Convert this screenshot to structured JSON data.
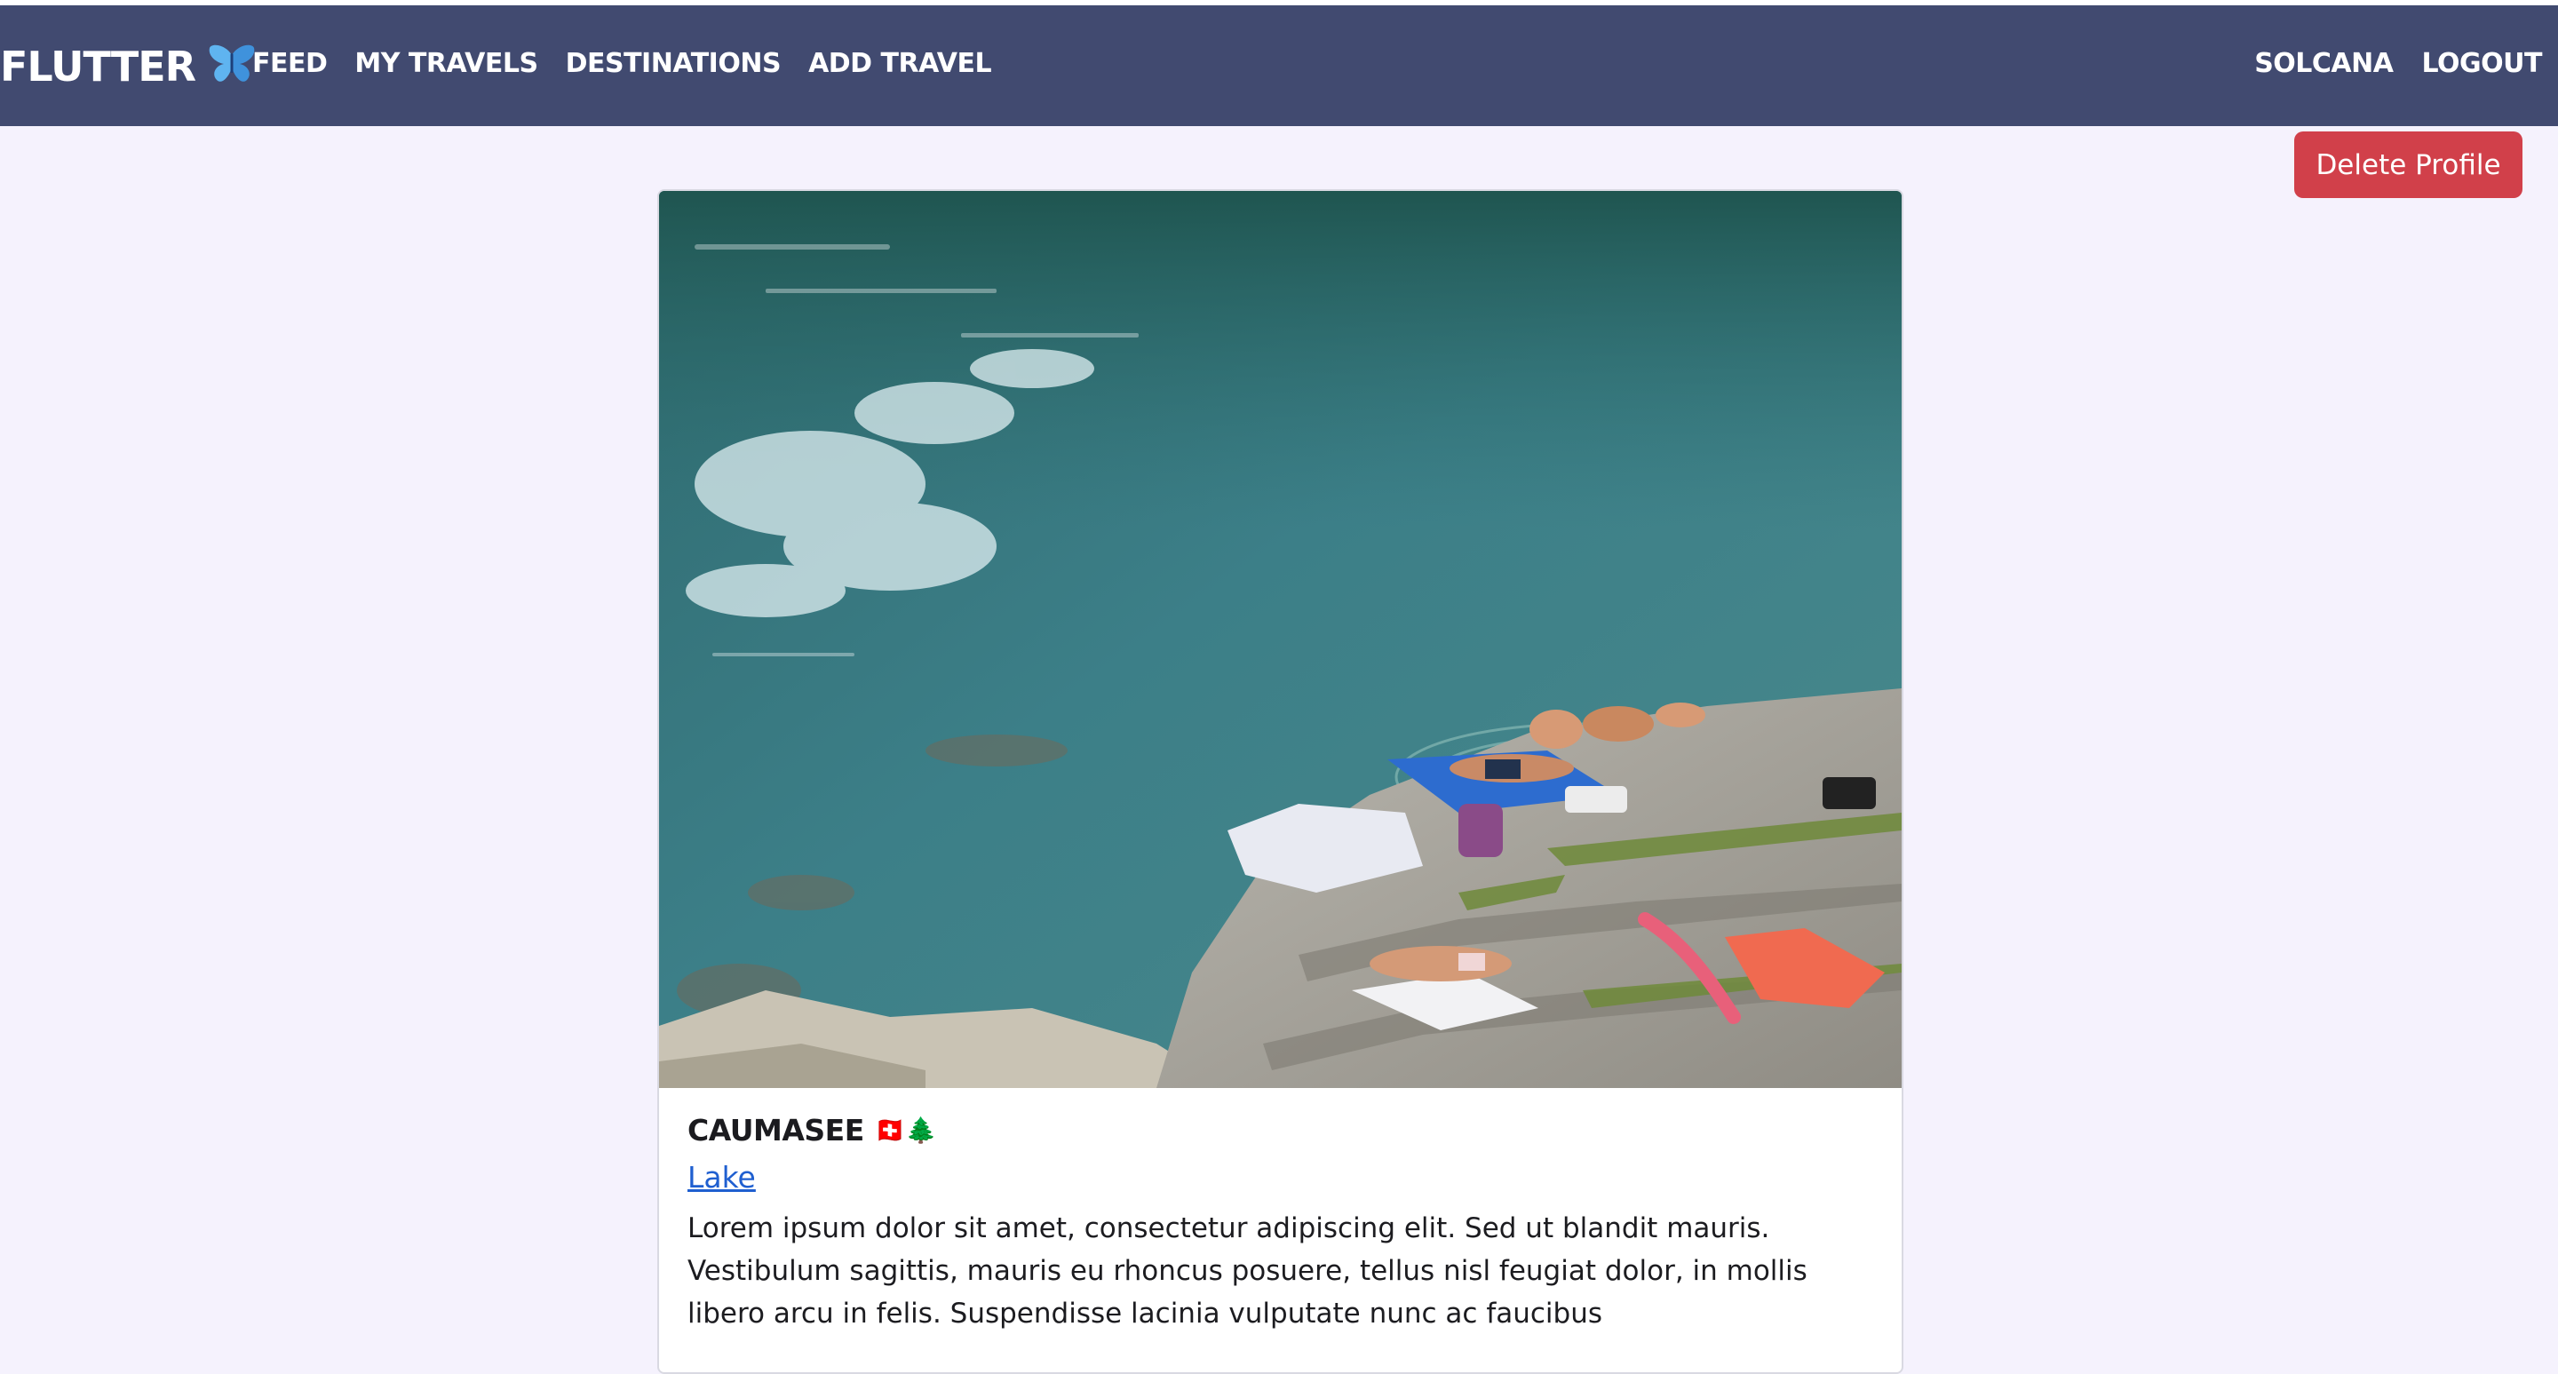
{
  "navbar": {
    "brand": "FLUTTER",
    "brand_icon": "butterfly-icon",
    "links": [
      "FEED",
      "MY TRAVELS",
      "DESTINATIONS",
      "ADD TRAVEL"
    ],
    "right_links": [
      "SOLCANA",
      "LOGOUT"
    ]
  },
  "profile": {
    "delete_label": "Delete Profile"
  },
  "post": {
    "title": "CAUMASEE",
    "flags": "🇨🇭🌲",
    "category": "Lake",
    "description": "Lorem ipsum dolor sit amet, consectetur adipiscing elit. Sed ut blandit mauris. Vestibulum sagittis, mauris eu rhoncus posuere, tellus nisl feugiat dolor, in mollis libero arcu in felis. Suspendisse lacinia vulputate nunc ac faucibus",
    "image_alt": "Caumasee lake with sunbathers on rocks"
  },
  "colors": {
    "navbar": "#414a70",
    "background": "#f5f2fd",
    "danger": "#d1404a",
    "link": "#1f5fd0"
  }
}
